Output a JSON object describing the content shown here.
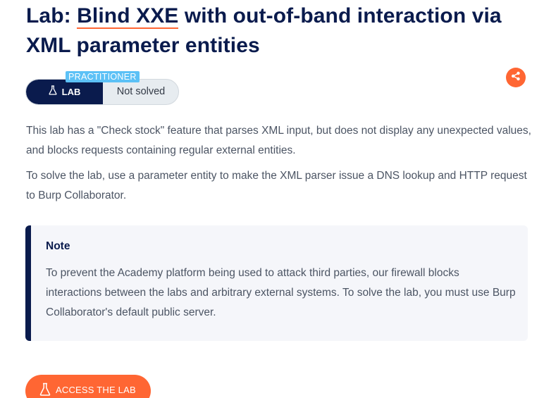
{
  "header": {
    "title_prefix": "Lab: ",
    "title_link": "Blind XXE",
    "title_suffix": " with out-of-band interaction via XML parameter entities"
  },
  "badge": {
    "level": "PRACTITIONER",
    "lab_label": "LAB",
    "status": "Not solved"
  },
  "description": {
    "paragraph1": "This lab has a \"Check stock\" feature that parses XML input, but does not display any unexpected values, and blocks requests containing regular external entities.",
    "paragraph2": "To solve the lab, use a parameter entity to make the XML parser issue a DNS lookup and HTTP request to Burp Collaborator."
  },
  "note": {
    "title": "Note",
    "body": "To prevent the Academy platform being used to attack third parties, our firewall blocks interactions between the labs and arbitrary external systems. To solve the lab, you must use Burp Collaborator's default public server."
  },
  "actions": {
    "access_label": "ACCESS THE LAB"
  },
  "icons": {
    "flask": "flask-icon",
    "share": "share-icon"
  },
  "colors": {
    "title": "#0a1b4d",
    "accent": "#ff6633",
    "level": "#5cc1f6",
    "lab_pill": "#0a1b4d",
    "status_pill": "#e7ecf0",
    "note_bg": "#f5f6fa"
  }
}
